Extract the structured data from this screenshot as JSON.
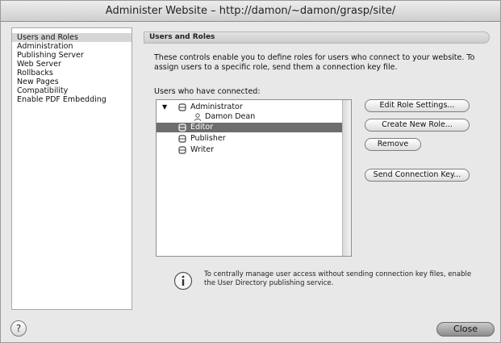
{
  "window": {
    "title": "Administer Website – http://damon/~damon/grasp/site/"
  },
  "sidebar": {
    "items": [
      {
        "label": "Users and Roles",
        "selected": true
      },
      {
        "label": "Administration"
      },
      {
        "label": "Publishing Server"
      },
      {
        "label": "Web Server"
      },
      {
        "label": "Rollbacks"
      },
      {
        "label": "New Pages"
      },
      {
        "label": "Compatibility"
      },
      {
        "label": "Enable PDF Embedding"
      }
    ]
  },
  "content": {
    "header": "Users and Roles",
    "description": "These controls enable you to define roles for users who connect to your website. To assign users to a specific role, send them a connection key file.",
    "users_label": "Users who have connected:",
    "user_list": [
      {
        "label": "Administrator",
        "icon": "role-icon",
        "level": 0,
        "expanded": true
      },
      {
        "label": "Damon Dean",
        "icon": "user-icon",
        "level": 1
      },
      {
        "label": "Editor",
        "icon": "role-icon",
        "level": 0,
        "selected": true
      },
      {
        "label": "Publisher",
        "icon": "role-icon",
        "level": 0
      },
      {
        "label": "Writer",
        "icon": "role-icon",
        "level": 0
      }
    ],
    "buttons": {
      "edit_role": "Edit Role Settings...",
      "create_role": "Create New Role...",
      "remove": "Remove",
      "send_key": "Send Connection Key..."
    },
    "info_note": "To centrally manage user access without sending connection key files, enable the User Directory publishing service."
  },
  "footer": {
    "help_label": "?",
    "close_label": "Close"
  },
  "colors": {
    "selected_row": "#6d6d6d",
    "sidebar_selected": "#d6d6d6"
  }
}
